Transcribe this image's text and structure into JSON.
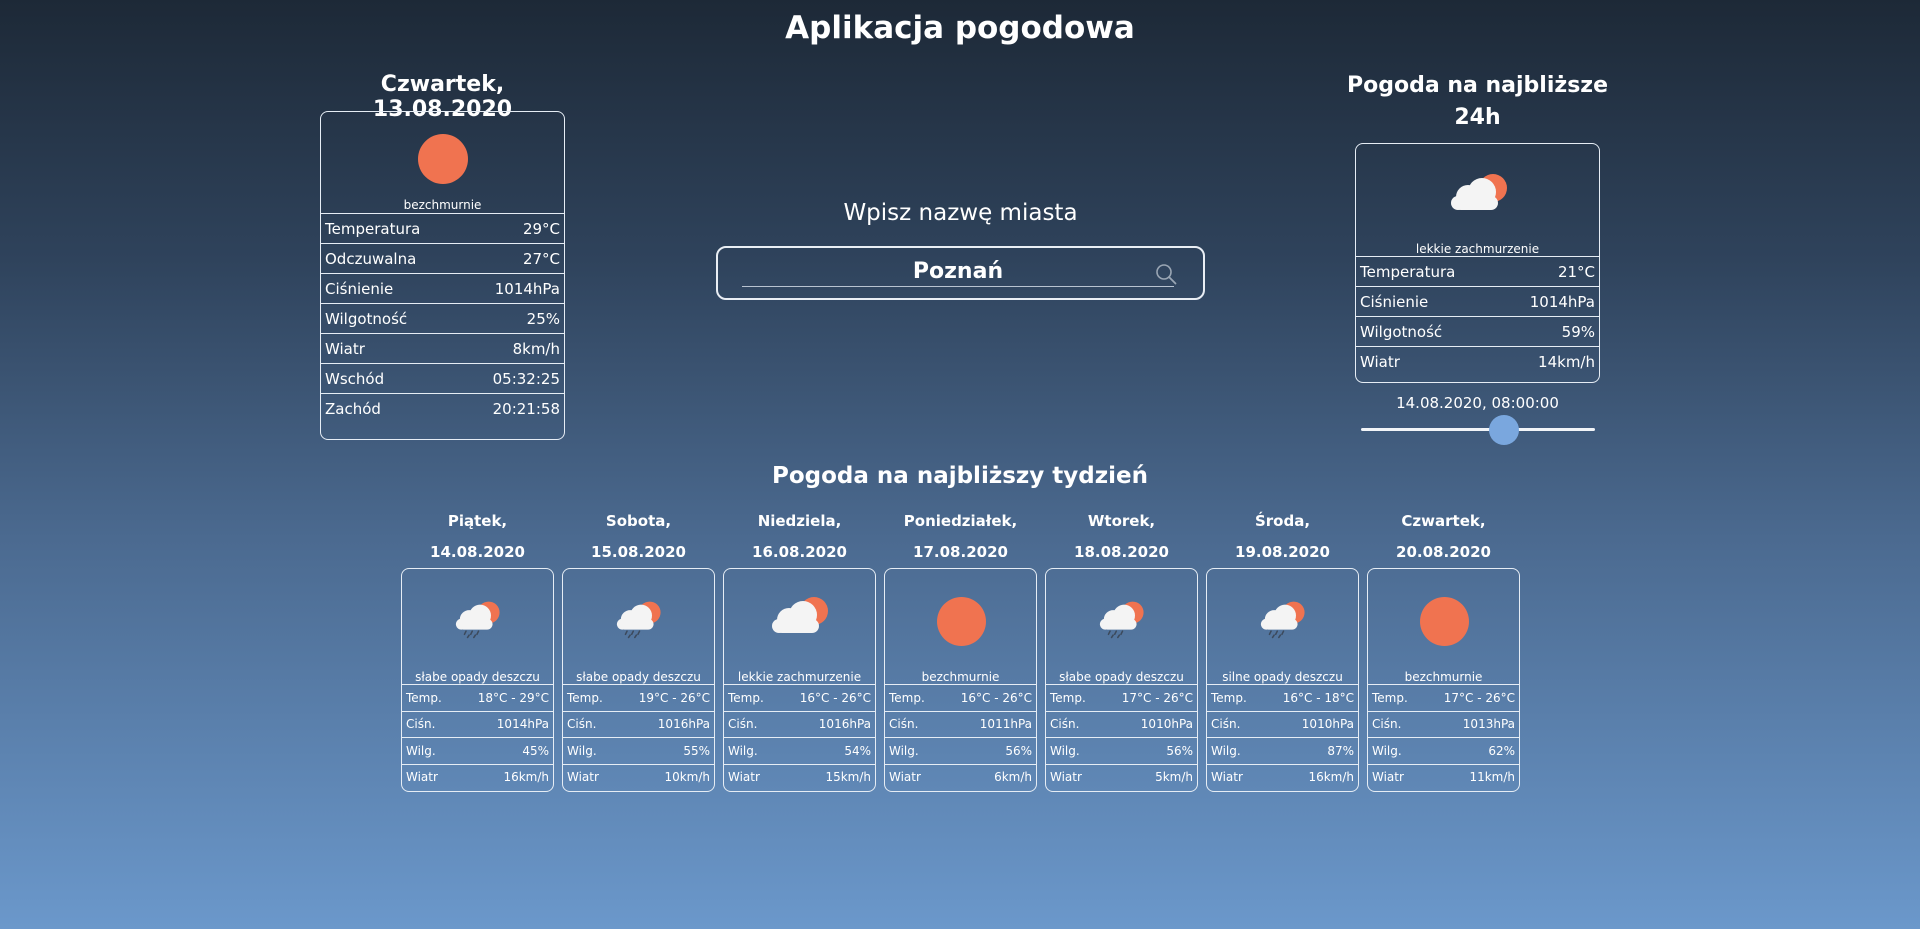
{
  "app": {
    "title": "Aplikacja pogodowa"
  },
  "today": {
    "title": "Czwartek, 13.08.2020",
    "icon": "sun-icon",
    "desc": "bezchmurnie",
    "rows": [
      {
        "label": "Temperatura",
        "value": "29°C"
      },
      {
        "label": "Odczuwalna",
        "value": "27°C"
      },
      {
        "label": "Ciśnienie",
        "value": "1014hPa"
      },
      {
        "label": "Wilgotność",
        "value": "25%"
      },
      {
        "label": "Wiatr",
        "value": "8km/h"
      },
      {
        "label": "Wschód",
        "value": "05:32:25"
      },
      {
        "label": "Zachód",
        "value": "20:21:58"
      }
    ]
  },
  "search": {
    "label": "Wpisz nazwę miasta",
    "value": "Poznań",
    "placeholder": ""
  },
  "hourly": {
    "title_line1": "Pogoda na najbliższe",
    "title_line2": "24h",
    "icon": "cloud-sun-icon",
    "desc": "lekkie zachmurzenie",
    "rows": [
      {
        "label": "Temperatura",
        "value": "21°C"
      },
      {
        "label": "Ciśnienie",
        "value": "1014hPa"
      },
      {
        "label": "Wilgotność",
        "value": "59%"
      },
      {
        "label": "Wiatr",
        "value": "14km/h"
      }
    ],
    "time_label": "14.08.2020, 08:00:00",
    "slider_fraction": 0.61
  },
  "week": {
    "title": "Pogoda na najbliższy tydzień",
    "days": [
      {
        "name": "Piątek,",
        "date": "14.08.2020",
        "icon": "rain-sun-icon",
        "desc": "słabe opady deszczu",
        "rows": [
          {
            "label": "Temp.",
            "value": "18°C - 29°C"
          },
          {
            "label": "Ciśn.",
            "value": "1014hPa"
          },
          {
            "label": "Wilg.",
            "value": "45%"
          },
          {
            "label": "Wiatr",
            "value": "16km/h"
          }
        ]
      },
      {
        "name": "Sobota,",
        "date": "15.08.2020",
        "icon": "rain-sun-icon",
        "desc": "słabe opady deszczu",
        "rows": [
          {
            "label": "Temp.",
            "value": "19°C - 26°C"
          },
          {
            "label": "Ciśn.",
            "value": "1016hPa"
          },
          {
            "label": "Wilg.",
            "value": "55%"
          },
          {
            "label": "Wiatr",
            "value": "10km/h"
          }
        ]
      },
      {
        "name": "Niedziela,",
        "date": "16.08.2020",
        "icon": "cloud-sun-icon",
        "desc": "lekkie zachmurzenie",
        "rows": [
          {
            "label": "Temp.",
            "value": "16°C - 26°C"
          },
          {
            "label": "Ciśn.",
            "value": "1016hPa"
          },
          {
            "label": "Wilg.",
            "value": "54%"
          },
          {
            "label": "Wiatr",
            "value": "15km/h"
          }
        ]
      },
      {
        "name": "Poniedziałek,",
        "date": "17.08.2020",
        "icon": "sun-icon",
        "desc": "bezchmurnie",
        "rows": [
          {
            "label": "Temp.",
            "value": "16°C - 26°C"
          },
          {
            "label": "Ciśn.",
            "value": "1011hPa"
          },
          {
            "label": "Wilg.",
            "value": "56%"
          },
          {
            "label": "Wiatr",
            "value": "6km/h"
          }
        ]
      },
      {
        "name": "Wtorek,",
        "date": "18.08.2020",
        "icon": "rain-sun-icon",
        "desc": "słabe opady deszczu",
        "rows": [
          {
            "label": "Temp.",
            "value": "17°C - 26°C"
          },
          {
            "label": "Ciśn.",
            "value": "1010hPa"
          },
          {
            "label": "Wilg.",
            "value": "56%"
          },
          {
            "label": "Wiatr",
            "value": "5km/h"
          }
        ]
      },
      {
        "name": "Środa,",
        "date": "19.08.2020",
        "icon": "rain-sun-icon",
        "desc": "silne opady deszczu",
        "rows": [
          {
            "label": "Temp.",
            "value": "16°C - 18°C"
          },
          {
            "label": "Ciśn.",
            "value": "1010hPa"
          },
          {
            "label": "Wilg.",
            "value": "87%"
          },
          {
            "label": "Wiatr",
            "value": "16km/h"
          }
        ]
      },
      {
        "name": "Czwartek,",
        "date": "20.08.2020",
        "icon": "sun-icon",
        "desc": "bezchmurnie",
        "rows": [
          {
            "label": "Temp.",
            "value": "17°C - 26°C"
          },
          {
            "label": "Ciśn.",
            "value": "1013hPa"
          },
          {
            "label": "Wilg.",
            "value": "62%"
          },
          {
            "label": "Wiatr",
            "value": "11km/h"
          }
        ]
      }
    ]
  },
  "colors": {
    "sun": "#f07350",
    "cloud": "#f4f4f4",
    "rain": "#3c4a5c",
    "slider_thumb": "#7aa7de"
  }
}
